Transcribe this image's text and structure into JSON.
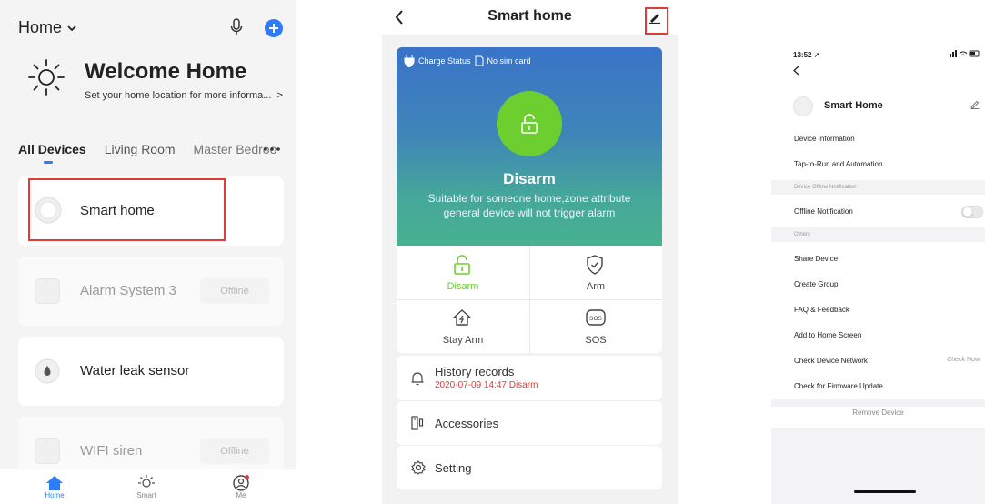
{
  "screen1": {
    "home_title": "Home",
    "welcome_title": "Welcome Home",
    "welcome_subtitle": "Set your home location for more informa...",
    "tabs": [
      "All Devices",
      "Living Room",
      "Master Bedroo"
    ],
    "devices": [
      {
        "name": "Smart home",
        "status": ""
      },
      {
        "name": "Alarm System 3",
        "status": "Offline"
      },
      {
        "name": "Water leak sensor",
        "status": ""
      },
      {
        "name": "WIFI siren",
        "status": "Offline"
      }
    ],
    "tabbar": [
      "Home",
      "Smart",
      "Me"
    ],
    "accent_color": "#2f7cf6"
  },
  "screen2": {
    "title": "Smart home",
    "charge_status": "Charge Status",
    "sim_status": "No sim card",
    "state": "Disarm",
    "state_desc": "Suitable for someone home,zone attribute general device will not trigger alarm",
    "modes": [
      {
        "label": "Disarm",
        "icon": "unlock-icon",
        "active": true
      },
      {
        "label": "Arm",
        "icon": "shield-check-icon",
        "active": false
      },
      {
        "label": "Stay Arm",
        "icon": "house-bolt-icon",
        "active": false
      },
      {
        "label": "SOS",
        "icon": "sos-icon",
        "active": false
      }
    ],
    "history_label": "History records",
    "history_entry": "2020-07-09 14:47 Disarm",
    "accessories_label": "Accessories",
    "setting_label": "Setting",
    "active_color": "#6dcf2f",
    "history_color": "#e03a3a"
  },
  "screen3": {
    "time": "13:52",
    "device_name": "Smart Home",
    "menu": {
      "device_information": "Device Information",
      "tap_to_run": "Tap-to-Run and Automation",
      "offline_section": "Device Offline Notification",
      "offline_notification": "Offline Notification",
      "others_section": "Others",
      "share_device": "Share Device",
      "create_group": "Create Group",
      "faq": "FAQ & Feedback",
      "add_home_screen": "Add to Home Screen",
      "check_network": "Check Device Network",
      "check_now": "Check Now",
      "firmware_update": "Check for Firmware Update"
    },
    "remove_device": "Remove Device",
    "offline_notification_enabled": false
  }
}
